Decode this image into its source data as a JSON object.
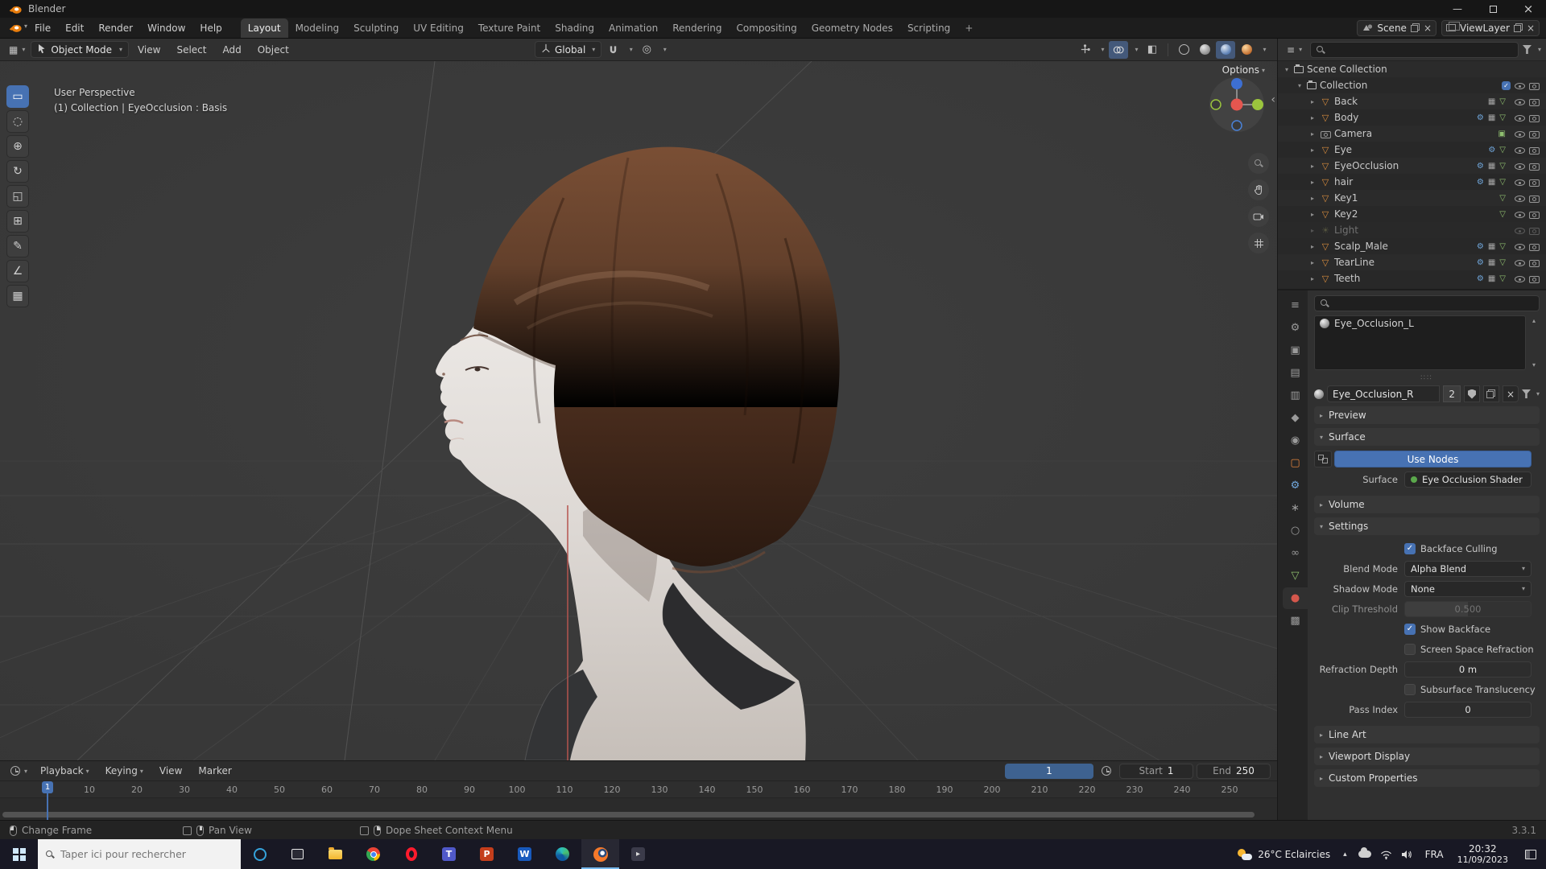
{
  "window": {
    "title": "Blender"
  },
  "menubar": {
    "menus": [
      "File",
      "Edit",
      "Render",
      "Window",
      "Help"
    ],
    "workspaces": [
      "Layout",
      "Modeling",
      "Sculpting",
      "UV Editing",
      "Texture Paint",
      "Shading",
      "Animation",
      "Rendering",
      "Compositing",
      "Geometry Nodes",
      "Scripting"
    ],
    "add_tab": "+",
    "scene": "Scene",
    "view_layer": "ViewLayer"
  },
  "vheader": {
    "mode": "Object Mode",
    "menus": [
      "View",
      "Select",
      "Add",
      "Object"
    ],
    "orientation": "Global",
    "options": "Options"
  },
  "viewport": {
    "perspective": "User Perspective",
    "context": "(1) Collection | EyeOcclusion : Basis"
  },
  "outliner": {
    "root": "Scene Collection",
    "collection": "Collection",
    "items": [
      {
        "label": "Back"
      },
      {
        "label": "Body"
      },
      {
        "label": "Camera"
      },
      {
        "label": "Eye"
      },
      {
        "label": "EyeOcclusion"
      },
      {
        "label": "hair"
      },
      {
        "label": "Key1"
      },
      {
        "label": "Key2"
      },
      {
        "label": "Light"
      },
      {
        "label": "Scalp_Male"
      },
      {
        "label": "TearLine"
      },
      {
        "label": "Teeth"
      }
    ]
  },
  "properties": {
    "slots": [
      "Eye_Occlusion_L"
    ],
    "material_name": "Eye_Occlusion_R",
    "users": "2",
    "panels": {
      "preview": "Preview",
      "surface": "Surface",
      "volume": "Volume",
      "settings": "Settings",
      "line_art": "Line Art",
      "viewport_display": "Viewport Display",
      "custom_properties": "Custom Properties"
    },
    "surface": {
      "use_nodes": "Use Nodes",
      "label": "Surface",
      "shader": "Eye Occlusion Shader"
    },
    "settings": {
      "backface_culling": "Backface Culling",
      "blend_mode_label": "Blend Mode",
      "blend_mode": "Alpha Blend",
      "shadow_mode_label": "Shadow Mode",
      "shadow_mode": "None",
      "clip_threshold_label": "Clip Threshold",
      "clip_threshold": "0.500",
      "show_backface": "Show Backface",
      "screen_space_refraction": "Screen Space Refraction",
      "refraction_depth_label": "Refraction Depth",
      "refraction_depth": "0 m",
      "subsurface_translucency": "Subsurface Translucency",
      "pass_index_label": "Pass Index",
      "pass_index": "0"
    }
  },
  "timeline": {
    "menus": [
      "Playback",
      "Keying",
      "View",
      "Marker"
    ],
    "current_frame": "1",
    "start_label": "Start",
    "start_value": "1",
    "end_label": "End",
    "end_value": "250",
    "ticks": [
      "1",
      "10",
      "20",
      "30",
      "40",
      "50",
      "60",
      "70",
      "80",
      "90",
      "100",
      "110",
      "120",
      "130",
      "140",
      "150",
      "160",
      "170",
      "180",
      "190",
      "200",
      "210",
      "220",
      "230",
      "240",
      "250"
    ]
  },
  "statusbar": {
    "left": "Change Frame",
    "middle": "Pan View",
    "context": "Dope Sheet Context Menu",
    "version": "3.3.1"
  },
  "taskbar": {
    "search_placeholder": "Taper ici pour rechercher",
    "weather": "26°C Eclaircies",
    "lang": "FRA",
    "time": "20:32",
    "date": "11/09/2023"
  }
}
